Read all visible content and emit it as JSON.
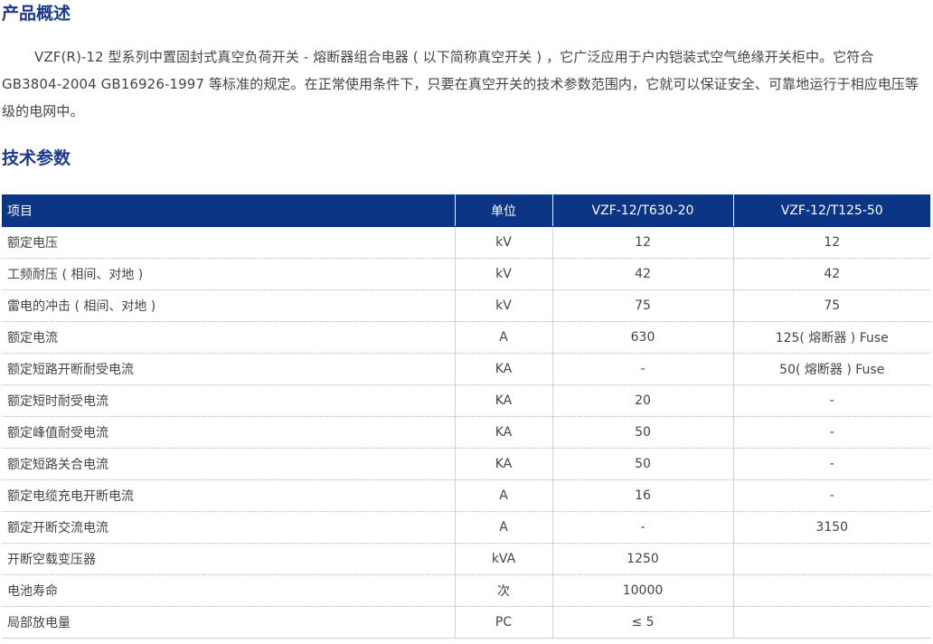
{
  "overview": {
    "title": "产品概述",
    "text": "VZF(R)-12 型系列中置固封式真空负荷开关 - 熔断器组合电器 ( 以下简称真空开关 ) ，它广泛应用于户内铠装式空气绝缘开关柜中。它符合 GB3804-2004 GB16926-1997 等标准的规定。在正常使用条件下，只要在真空开关的技术参数范围内，它就可以保证安全、可靠地运行于相应电压等级的电网中。"
  },
  "specs": {
    "title": "技术参数",
    "headers": [
      "项目",
      "单位",
      "VZF-12/T630-20",
      "VZF-12/T125-50"
    ],
    "rows": [
      [
        "额定电压",
        "kV",
        "12",
        "12"
      ],
      [
        "工频耐压 ( 相间、对地 )",
        "kV",
        "42",
        "42"
      ],
      [
        "雷电的冲击 ( 相间、对地 )",
        "kV",
        "75",
        "75"
      ],
      [
        "额定电流",
        "A",
        "630",
        "125( 熔断器 ) Fuse"
      ],
      [
        "额定短路开断耐受电流",
        "KA",
        "-",
        "50( 熔断器 ) Fuse"
      ],
      [
        "额定短时耐受电流",
        "KA",
        "20",
        "-"
      ],
      [
        "额定峰值耐受电流",
        "KA",
        "50",
        "-"
      ],
      [
        "额定短路关合电流",
        "KA",
        "50",
        "-"
      ],
      [
        "额定电缆充电开断电流",
        "A",
        "16",
        "-"
      ],
      [
        "额定开断交流电流",
        "A",
        "-",
        "3150"
      ],
      [
        "开断空载变压器",
        "kVA",
        "1250",
        ""
      ],
      [
        "电池寿命",
        "次",
        "10000",
        ""
      ],
      [
        "局部放电量",
        "PC",
        "≤ 5",
        ""
      ]
    ]
  }
}
